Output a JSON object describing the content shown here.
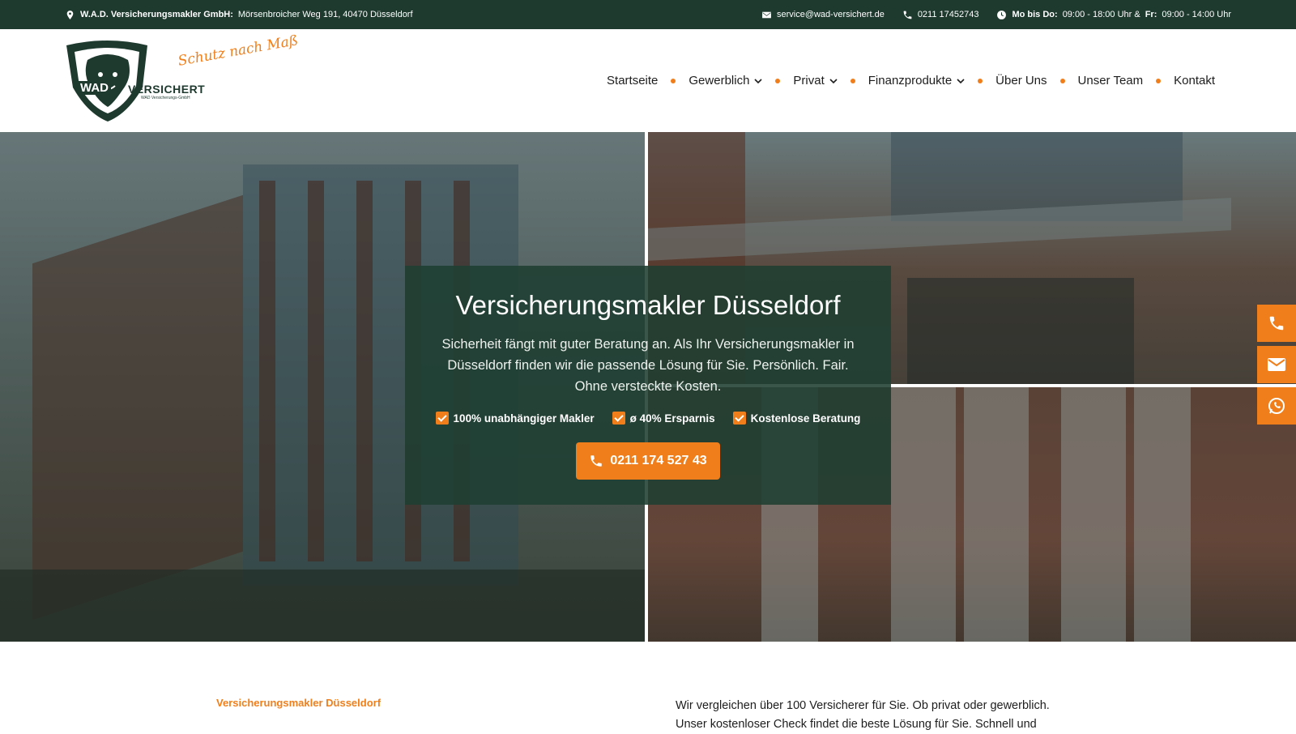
{
  "topbar": {
    "company": "W.A.D. Versicherungsmakler GmbH:",
    "address": "Mörsenbroicher Weg 191, 40470 Düsseldorf",
    "email": "service@wad-versichert.de",
    "phone": "0211 17452743",
    "hours_label_1": "Mo bis Do:",
    "hours_value_1": "09:00 - 18:00 Uhr &",
    "hours_label_2": "Fr:",
    "hours_value_2": "09:00 - 14:00 Uhr"
  },
  "logo": {
    "brand_wad": "WAD",
    "brand_versichert": "VERSICHERT",
    "brand_sub": "WAD Versicherungs-GmbH",
    "tagline": "Schutz nach Maß"
  },
  "nav": {
    "items": [
      {
        "label": "Startseite",
        "dropdown": false
      },
      {
        "label": "Gewerblich",
        "dropdown": true
      },
      {
        "label": "Privat",
        "dropdown": true
      },
      {
        "label": "Finanzprodukte",
        "dropdown": true
      },
      {
        "label": "Über Uns",
        "dropdown": false
      },
      {
        "label": "Unser Team",
        "dropdown": false
      },
      {
        "label": "Kontakt",
        "dropdown": false
      }
    ]
  },
  "hero": {
    "title": "Versicherungsmakler Düsseldorf",
    "text": "Sicherheit fängt mit guter Beratung an. Als Ihr Versicherungsmakler in Düsseldorf finden wir die passende Lösung für Sie. Persönlich. Fair. Ohne versteckte Kosten.",
    "features": [
      "100% unabhängiger Makler",
      "ø 40% Ersparnis",
      "Kostenlose Beratung"
    ],
    "cta_label": "0211 174 527 43"
  },
  "intro": {
    "label": "Versicherungsmakler Düsseldorf",
    "text": "Wir vergleichen über 100 Versicherer für Sie. Ob privat oder gewerblich. Unser kostenloser Check findet die beste Lösung für Sie. Schnell und"
  },
  "colors": {
    "accent": "#f07f1b",
    "dark_green": "#1e3a2f"
  },
  "side_tabs": [
    "phone-icon",
    "mail-icon",
    "whatsapp-icon"
  ]
}
